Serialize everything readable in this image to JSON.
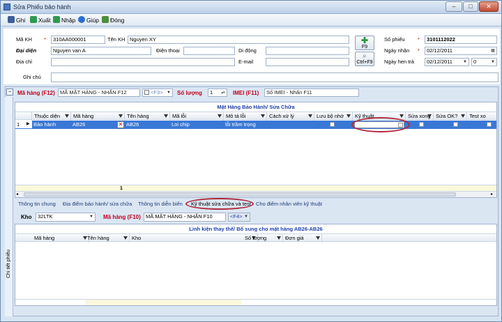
{
  "window": {
    "title": "Sửa Phiếu bảo hành",
    "minimize": "–",
    "maximize": "□",
    "close": "✕"
  },
  "toolbar": {
    "save": "Ghi",
    "export": "Xuất",
    "import": "Nhập",
    "help": "Giúp",
    "close": "Đóng"
  },
  "form": {
    "ma_kh_label": "Mã KH",
    "ma_kh": "310AA000001",
    "ten_kh_label": "Tên KH",
    "ten_kh": "Nguyen XY",
    "dai_dien_label": "Đại diện",
    "dai_dien": "Nguyen van A",
    "dien_thoai_label": "Điện thoại",
    "dien_thoai": "",
    "di_dong_label": "Di động",
    "di_dong": "",
    "dia_chi_label": "Địa chỉ",
    "dia_chi": "",
    "email_label": "E-mail",
    "email": "",
    "ghi_chu_label": "Ghi chú",
    "ghi_chu": "",
    "f9_label": "F9",
    "ctrl_f9_label": "Ctrl+F9",
    "so_phieu_label": "Số phiếu",
    "so_phieu": "3101112022",
    "ngay_nhan_label": "Ngày nhận",
    "ngay_nhan": "02/12/2011",
    "ngay_hen_tra_label": "Ngày hen trả",
    "ngay_hen_tra": "02/12/2011",
    "ngay_hen_tra_extra": "0",
    "required_mark": "*"
  },
  "item_bar": {
    "ma_hang_label": "Mã hàng (F12)",
    "ma_hang_placeholder": "MÃ MẶT HÀNG - NHẤN F12",
    "f3_hint": "<F3>",
    "so_luong_label": "Số lượng",
    "so_luong": "1",
    "imei_label": "IMEI (F11)",
    "imei_placeholder": "Số IMEI - Nhấn F11"
  },
  "grid1": {
    "title": "Mặt Hàng Bảo Hành/ Sửa Chữa",
    "columns": [
      "Thuộc diện",
      "Mã hàng",
      "Tên hàng",
      "Mã lỗi",
      "Mô tả lỗi",
      "Cách xử lý",
      "Lưu bộ nhớ",
      "Kỹ thuật",
      "Sửa xong",
      "Sửa OK?",
      "Test xo"
    ],
    "row": {
      "num": "1",
      "thuoc_dien": "Bảo hành",
      "ma_hang": "AB26",
      "ten_hang": "AB26",
      "ma_loi": "Loi chip",
      "mo_ta_loi": "lỗi trầm trọng"
    },
    "footer_count": "1"
  },
  "side_tab": "Chi tiết phiếu",
  "tabs": [
    "Thông tin chung",
    "Địa điểm bảo hành/ sửa chữa",
    "Thông tin diễn biến",
    "Kỹ thuật sửa chữa và test",
    "Cho điểm nhân viên kỹ thuật"
  ],
  "kho_bar": {
    "kho_label": "Kho",
    "kho_value": "32LTK",
    "ma_hang_label": "Mã hàng (F10)",
    "ma_hang_placeholder": "MÃ MẶT HÀNG - NHẤN F10",
    "f4_hint": "<F4>"
  },
  "grid2": {
    "title": "Linh kiện thay thế/ Bổ sung cho mặt hàng AB26-AB26",
    "columns": [
      "Mã hàng",
      "Tên hàng",
      "Kho",
      "Số lượng",
      "Đơn giá"
    ]
  },
  "colors": {
    "accent": "#1e3fa8",
    "selected_row": "#3a78d6",
    "required": "#c0001a",
    "highlight_circle": "#b0293a"
  }
}
